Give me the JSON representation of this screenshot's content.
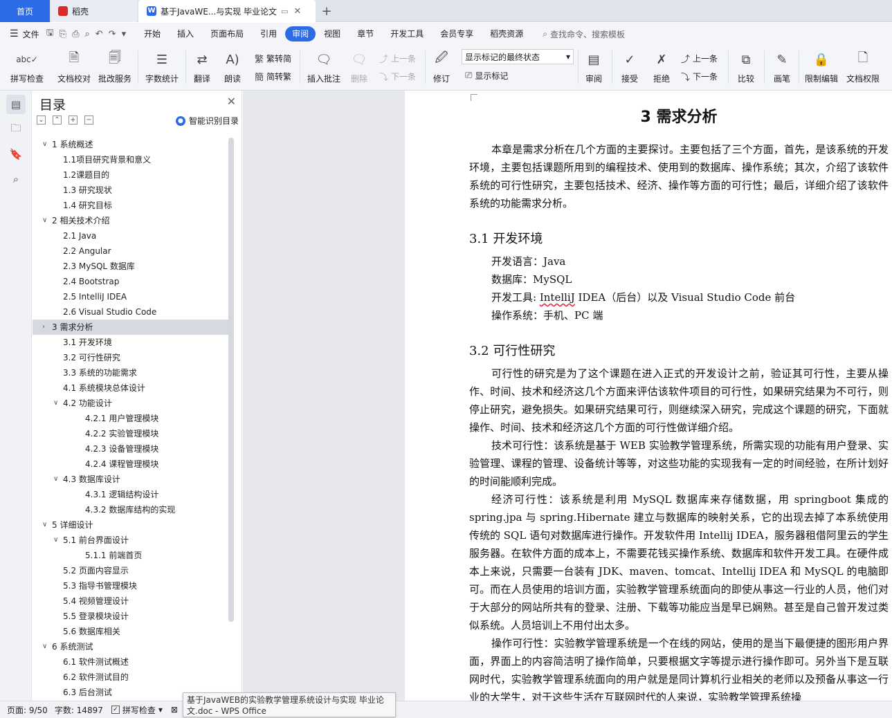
{
  "tabs": {
    "home": "首页",
    "daoke": "稻壳",
    "doc": "基于JavaWE...与实现 毕业论文",
    "add": "+"
  },
  "menubar": {
    "file": "文件",
    "tabs": [
      "开始",
      "插入",
      "页面布局",
      "引用",
      "审阅",
      "视图",
      "章节",
      "开发工具",
      "会员专享",
      "稻壳资源"
    ],
    "active_tab": "审阅",
    "search": "查找命令、搜索模板"
  },
  "ribbon": {
    "spell": "拼写检查",
    "proofread": "文档校对",
    "batch": "批改服务",
    "wordcount": "字数统计",
    "translate": "翻译",
    "read": "朗读",
    "trad": "繁转简",
    "simp": "简转繁",
    "insert_comment": "插入批注",
    "delete": "删除",
    "prev_comment": "上一条",
    "next_comment": "下一条",
    "revise": "修订",
    "display_state": "显示标记的最终状态",
    "show_marks": "显示标记",
    "review": "审阅",
    "accept": "接受",
    "reject": "拒绝",
    "prev_change": "上一条",
    "next_change": "下一条",
    "compare": "比较",
    "pen": "画笔",
    "restrict": "限制编辑",
    "permission": "文档权限"
  },
  "toc": {
    "title": "目录",
    "smart": "智能识别目录",
    "items": [
      {
        "label": "1  系统概述",
        "level": 1,
        "caret": "v"
      },
      {
        "label": "1.1项目研究背景和意义",
        "level": 2
      },
      {
        "label": "1.2课题目的",
        "level": 2
      },
      {
        "label": "1.3  研究现状",
        "level": 2
      },
      {
        "label": "1.4  研究目标",
        "level": 2
      },
      {
        "label": "2  相关技术介绍",
        "level": 1,
        "caret": "v"
      },
      {
        "label": "2.1 Java",
        "level": 2
      },
      {
        "label": "2.2 Angular",
        "level": 2
      },
      {
        "label": "2.3 MySQL 数据库",
        "level": 2
      },
      {
        "label": "2.4 Bootstrap",
        "level": 2
      },
      {
        "label": "2.5 IntelliJ IDEA",
        "level": 2
      },
      {
        "label": "2.6 Visual Studio Code",
        "level": 2
      },
      {
        "label": "3  需求分析",
        "level": 1,
        "caret": ">",
        "selected": true
      },
      {
        "label": "3.1  开发环境",
        "level": 2
      },
      {
        "label": "3.2  可行性研究",
        "level": 2
      },
      {
        "label": "3.3  系统的功能需求",
        "level": 2
      },
      {
        "label": "4.1  系统模块总体设计",
        "level": 2
      },
      {
        "label": "4.2  功能设计",
        "level": 2,
        "caret": "v"
      },
      {
        "label": "4.2.1  用户管理模块",
        "level": 3
      },
      {
        "label": "4.2.2  实验管理模块",
        "level": 3
      },
      {
        "label": "4.2.3  设备管理模块",
        "level": 3
      },
      {
        "label": "4.2.4  课程管理模块",
        "level": 3
      },
      {
        "label": "4.3  数据库设计",
        "level": 2,
        "caret": "v"
      },
      {
        "label": "4.3.1 逻辑结构设计",
        "level": 3
      },
      {
        "label": "4.3.2 数据库结构的实现",
        "level": 3
      },
      {
        "label": "5  详细设计",
        "level": 1,
        "caret": "v"
      },
      {
        "label": "5.1  前台界面设计",
        "level": 2,
        "caret": "v"
      },
      {
        "label": "5.1.1 前端首页",
        "level": 3
      },
      {
        "label": "5.2  页面内容显示",
        "level": 2
      },
      {
        "label": "5.3  指导书管理模块",
        "level": 2
      },
      {
        "label": "5.4  视频管理设计",
        "level": 2
      },
      {
        "label": "5.5  登录模块设计",
        "level": 2
      },
      {
        "label": "5.6  数据库相关",
        "level": 2
      },
      {
        "label": "6  系统测试",
        "level": 1,
        "caret": "v"
      },
      {
        "label": "6.1  软件测试概述",
        "level": 2
      },
      {
        "label": "6.2  软件测试目的",
        "level": 2
      },
      {
        "label": "6.3 后台测试",
        "level": 2
      }
    ]
  },
  "doc": {
    "chapter_title": "3  需求分析",
    "intro": "本章是需求分析在几个方面的主要探讨。主要包括了三个方面，首先，是该系统的开发环境，主要包括课题所用到的编程技术、使用到的数据库、操作系统；其次，介绍了该软件系统的可行性研究，主要包括技术、经济、操作等方面的可行性；最后，详细介绍了该软件系统的功能需求分析。",
    "s31": "3.1  开发环境",
    "env_lang": "开发语言：Java",
    "env_db": "数据库：MySQL",
    "env_tool_a": "开发工具: ",
    "env_tool_b": "IntelliJ",
    "env_tool_c": " IDEA（后台）以及 Visual Studio Code 前台",
    "env_os": "操作系统：手机、PC 端",
    "s32": "3.2  可行性研究",
    "p1": "可行性的研究是为了这个课题在进入正式的开发设计之前，验证其可行性，主要从操作、时间、技术和经济这几个方面来评估该软件项目的可行性，如果研究结果为不可行，则停止研究，避免损失。如果研究结果可行，则继续深入研究，完成这个课题的研究，下面就操作、时间、技术和经济这几个方面的可行性做详细介绍。",
    "p2": "技术可行性：该系统是基于 WEB 实验教学管理系统，所需实现的功能有用户登录、实验管理、课程的管理、设备统计等等，对这些功能的实现我有一定的时间经验，在所计划好的时间能顺利完成。",
    "p3": "经济可行性：该系统是利用 MySQL 数据库来存储数据，用 springboot 集成的 spring.jpa 与 spring.Hibernate 建立与数据库的映射关系，它的出现去掉了本系统使用传统的 SQL 语句对数据库进行操作。开发软件用 Intellij IDEA，服务器租借阿里云的学生服务器。在软件方面的成本上，不需要花钱买操作系统、数据库和软件开发工具。在硬件成本上来说，只需要一台装有 JDK、maven、tomcat、Intellij IDEA 和 MySQL 的电脑即可。而在人员使用的培训方面，实验教学管理系统面向的即使从事这一行业的人员，他们对于大部分的网站所共有的登录、注册、下载等功能应当是早已娴熟。甚至是自己曾开发过类似系统。人员培训上不用付出太多。",
    "p4": "操作可行性：实验教学管理系统是一个在线的网站，使用的是当下最便捷的图形用户界面，界面上的内容简洁明了操作简单，只要根据文字等提示进行操作即可。另外当下是互联网时代，实验教学管理系统面向的用户就是是同计算机行业相关的老师以及预备从事这一行业的大学生，对于这些生活在互联网时代的人来说，实验教学管理系统操"
  },
  "status": {
    "page": "页面: 9/50",
    "words": "字数: 14897",
    "spell": "拼写检查",
    "tooltip": "基于JavaWEB的实验教学管理系统设计与实现 毕业论文.doc - WPS Office"
  },
  "colors": {
    "accent": "#2b6be6",
    "selected_row": "#d5d9e0",
    "doc_bg": "#e6e8eb"
  }
}
